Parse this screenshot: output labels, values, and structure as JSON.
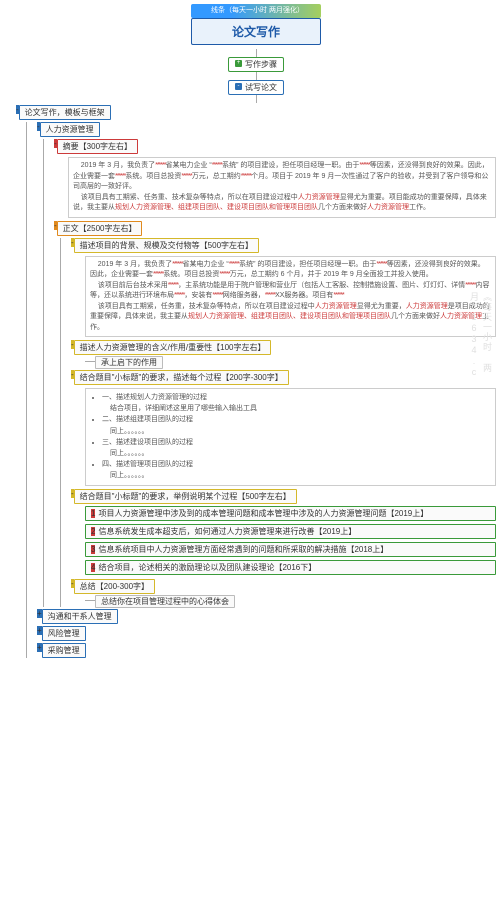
{
  "banner": "线条（每天一小时 两月强化）",
  "title": "论文写作",
  "steps_label": "写作步骤",
  "try_label": "试写论文",
  "root": "论文写作，模板与框架",
  "sections": {
    "hr": "人力资源管理",
    "comm": "沟通和干系人管理",
    "risk": "风险管理",
    "proc": "采购管理"
  },
  "abstract": {
    "title": "摘要【300字左右】",
    "text_1a": "2019 年 3 月，我负责了",
    "text_1b": "省某电力企业 “",
    "text_1c": "系统” 的项目建设，担任项目经理一职。由于",
    "text_1d": "等因素，还没得到良好的效果。因此，企业需要一套",
    "text_1e": "系统。项目总投资",
    "text_1f": "万元，总工期约",
    "text_1g": "个月。项目于 2019 年 9 月一次性通过了客户的验收，并受到了客户领导和公司高层的一致好评。",
    "text_2a": "该项目具有工期紧、任务重、技术复杂等特点，所以在项目建设过程中",
    "text_hl1": "人力资源管理",
    "text_2b": "显得尤为重要。项目能成功的重要保障，具体来说，我主要从",
    "text_hl2": "规划人力资源管理、组建项目团队、建设项目团队和管理项目团队",
    "text_2c": "几个方面来做好",
    "text_hl3": "人力资源管理",
    "text_2d": "工作。"
  },
  "body": {
    "title": "正文【2500字左右】",
    "bg": "描述项目的背景、规模及交付物等【500字左右】",
    "bg_text_1a": "2019 年 3 月，我负责了",
    "bg_text_1b": "省某电力企业 “",
    "bg_text_1c": "系统” 的项目建设，担任项目经理一职。由于",
    "bg_text_1d": "等因素，还没得到良好的效果。因此，企业需要一套",
    "bg_text_1e": "系统。项目总投资",
    "bg_text_1f": "万元，总工期约 6 个月，并于 2019 年 9 月全面投工并投入使用。",
    "bg_text_2a": "该项目前后台技术采用",
    "bg_text_2b": "，主系统功能是用于院户管理和营业厅（包括人工客服、控制措施设置、图片、灯灯灯、详情",
    "bg_text_2c": "内容等，还以系统进行环境布局",
    "bg_text_2d": "，安装有",
    "bg_text_2e": "网络服务器，",
    "bg_text_2f": "XX服务器。项目有",
    "bg_text_3a": "该项目具有工期紧，任务重，技术复杂等特点，所以在项目建设过程中",
    "bg_text_3b": "显得尤为重要，",
    "bg_text_3c": "是项目成功的重要保障，具体来说，我主要从",
    "bg_text_3d": "几个方面来做好",
    "bg_text_3e": "工作。",
    "meaning": "描述人力资源管理的含义/作用/重要性【100字左右】",
    "meaning_note": "承上启下的作用",
    "process": "结合题目\"小标题\"的要求，描述每个过程【200字-300字】",
    "process_items": {
      "p1": "一、描述规划人力资源管理的过程",
      "p1s": "结合项目，详细阐述这里用了哪些输入输出工具",
      "p2": "二、描述组建项目团队的过程",
      "p2s": "同上。。。。。。",
      "p3": "三、描述建设项目团队的过程",
      "p3s": "同上。。。。。。",
      "p4": "四、描述管理项目团队的过程",
      "p4s": "同上。。。。。。"
    },
    "example": "结合题目\"小标题\"的要求，举例说明某个过程【500字左右】",
    "examples": {
      "e1": "项目人力资源管理中涉及到的成本管理问题和成本管理中涉及的人力资源管理问题【2019上】",
      "e2": "信息系统发生成本超支后，如何通过人力资源管理来进行改善【2019上】",
      "e3": "信息系统项目中人力资源管理方面经常遇到的问题和所采取的解决措施【2018上】",
      "e4": "结合项目，论述相关的激励理论以及团队建设理论【2016下】"
    },
    "summary": "总结【200-300字】",
    "summary_note": "总结你在项目管理过程中的心得体会"
  },
  "mask": "******",
  "watermark": "《每天一小时 两月》1634.c"
}
